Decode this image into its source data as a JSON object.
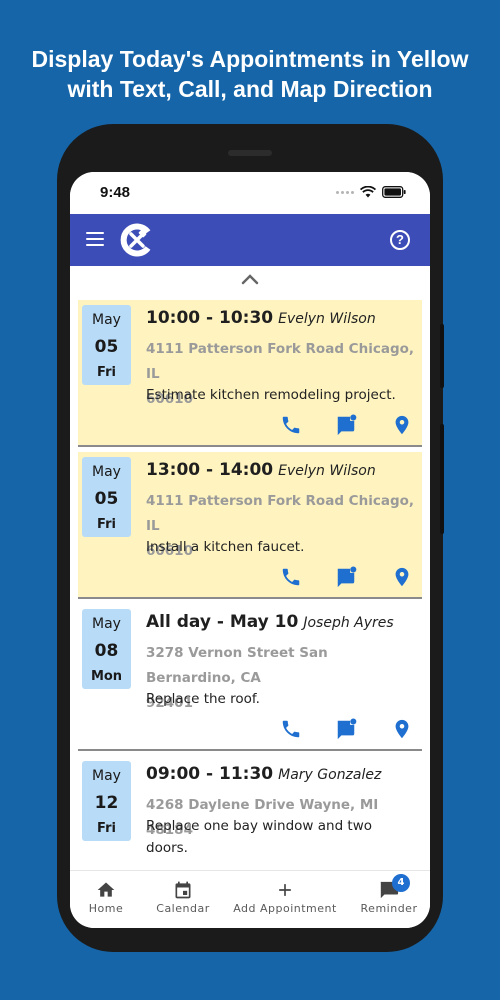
{
  "promo": {
    "line1": "Display Today's Appointments in Yellow",
    "line2": "with Text, Call, and Map Direction"
  },
  "status_bar": {
    "time": "9:48"
  },
  "app_bar": {
    "help_symbol": "?"
  },
  "appointments": [
    {
      "month": "May",
      "day": "05",
      "weekday": "Fri",
      "time": "10:00 - 10:30",
      "client": "Evelyn Wilson",
      "address_line1": "4111 Patterson Fork Road Chicago, IL",
      "address_line2": "60610",
      "description": "Estimate kitchen remodeling project.",
      "is_today": true
    },
    {
      "month": "May",
      "day": "05",
      "weekday": "Fri",
      "time": "13:00 - 14:00",
      "client": "Evelyn Wilson",
      "address_line1": "4111 Patterson Fork Road Chicago, IL",
      "address_line2": "60610",
      "description": "Install a kitchen faucet.",
      "is_today": true
    },
    {
      "month": "May",
      "day": "08",
      "weekday": "Mon",
      "time": "All day - May 10",
      "client": "Joseph Ayres",
      "address_line1": "3278 Vernon Street San Bernardino, CA",
      "address_line2": "92401",
      "description": "Replace the roof.",
      "is_today": false
    },
    {
      "month": "May",
      "day": "12",
      "weekday": "Fri",
      "time": "09:00 - 11:30",
      "client": "Mary Gonzalez",
      "address_line1": "4268 Daylene Drive Wayne, MI 48184",
      "address_line2": "",
      "description_line1": "Replace one bay window and two",
      "description_line2": "doors.",
      "is_today": false
    }
  ],
  "bottom_nav": {
    "home": "Home",
    "calendar": "Calendar",
    "add": "Add Appointment",
    "reminder": "Reminder",
    "reminder_badge": "4"
  },
  "colors": {
    "background": "#1565a8",
    "app_bar": "#3d4db7",
    "today_highlight": "#fff4c0",
    "date_box": "#b8dbf7",
    "action_icon": "#1f6fd0"
  },
  "icons": {
    "menu": "hamburger-icon",
    "logo": "tools-c-logo",
    "help": "help-circle-icon",
    "collapse": "chevron-up-icon",
    "call": "phone-icon",
    "text": "message-icon",
    "map": "map-pin-icon",
    "home": "home-icon",
    "calendar": "calendar-icon",
    "add": "plus-icon",
    "reminder": "chat-bubble-icon"
  }
}
